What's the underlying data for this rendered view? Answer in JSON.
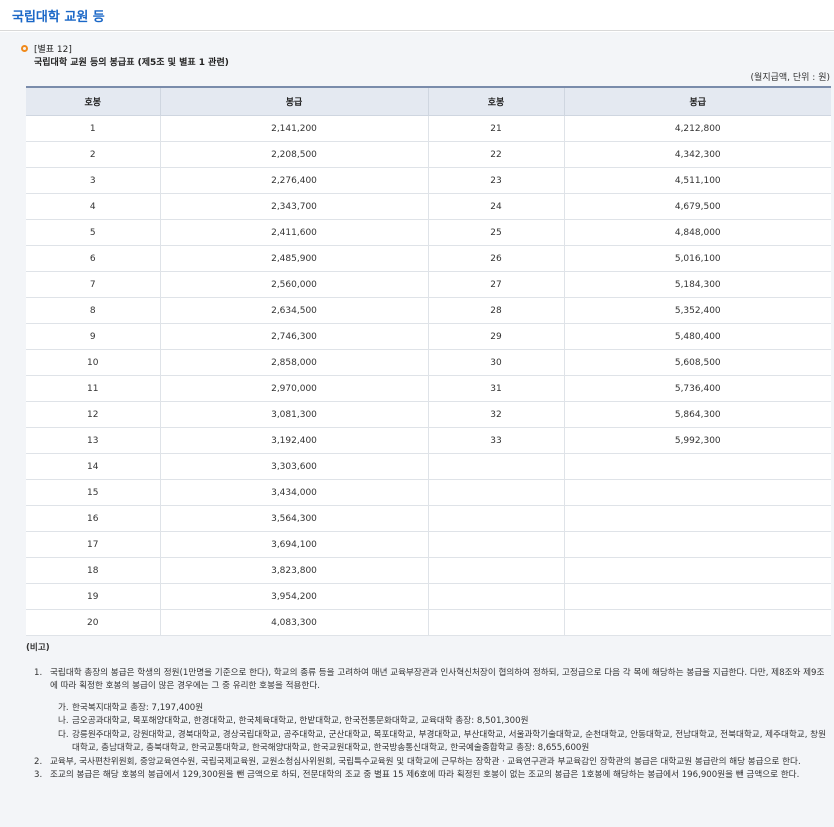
{
  "page_title": "국립대학 교원 등",
  "caption": {
    "label": "[별표 12]",
    "title": "국립대학 교원 등의 봉급표 (제5조 및 별표 1 관련)"
  },
  "unit": "(월지급액, 단위 : 원)",
  "table": {
    "headers": [
      "호봉",
      "봉급",
      "호봉",
      "봉급"
    ],
    "rows": [
      [
        "1",
        "2,141,200",
        "21",
        "4,212,800"
      ],
      [
        "2",
        "2,208,500",
        "22",
        "4,342,300"
      ],
      [
        "3",
        "2,276,400",
        "23",
        "4,511,100"
      ],
      [
        "4",
        "2,343,700",
        "24",
        "4,679,500"
      ],
      [
        "5",
        "2,411,600",
        "25",
        "4,848,000"
      ],
      [
        "6",
        "2,485,900",
        "26",
        "5,016,100"
      ],
      [
        "7",
        "2,560,000",
        "27",
        "5,184,300"
      ],
      [
        "8",
        "2,634,500",
        "28",
        "5,352,400"
      ],
      [
        "9",
        "2,746,300",
        "29",
        "5,480,400"
      ],
      [
        "10",
        "2,858,000",
        "30",
        "5,608,500"
      ],
      [
        "11",
        "2,970,000",
        "31",
        "5,736,400"
      ],
      [
        "12",
        "3,081,300",
        "32",
        "5,864,300"
      ],
      [
        "13",
        "3,192,400",
        "33",
        "5,992,300"
      ],
      [
        "14",
        "3,303,600",
        "",
        ""
      ],
      [
        "15",
        "3,434,000",
        "",
        ""
      ],
      [
        "16",
        "3,564,300",
        "",
        ""
      ],
      [
        "17",
        "3,694,100",
        "",
        ""
      ],
      [
        "18",
        "3,823,800",
        "",
        ""
      ],
      [
        "19",
        "3,954,200",
        "",
        ""
      ],
      [
        "20",
        "4,083,300",
        "",
        ""
      ]
    ]
  },
  "notes": {
    "heading": "(비고)",
    "items": [
      {
        "num": "1.",
        "text": "국립대학 총장의 봉급은 학생의 정원(1만명을 기준으로 한다), 학교의 종류 등을 고려하여 매년 교육부장관과 인사혁신처장이 협의하여 정하되, 고정급으로 다음 각 목에 해당하는 봉급을 지급한다. 다만, 제8조와 제9조에 따라 획정한 호봉의 봉급이 많은 경우에는 그 중 유리한 호봉을 적용한다."
      },
      {
        "num": "2.",
        "text": "교육부, 국사편찬위원회, 중앙교육연수원, 국립국제교육원, 교원소청심사위원회, 국립특수교육원 및 대학교에 근무하는 장학관ㆍ교육연구관과 부교육감인 장학관의 봉급은 대학교원 봉급란의 해당 봉급으로 한다."
      },
      {
        "num": "3.",
        "text": "조교의 봉급은 해당 호봉의 봉급에서 129,300원을 뺀 금액으로 하되, 전문대학의 조교 중 별표 15 제6호에 따라 획정된 호봉이 없는 조교의 봉급은 1호봉에 해당하는 봉급에서 196,900원을 뺀 금액으로 한다."
      }
    ],
    "sub_items": [
      {
        "num": "가.",
        "text": "한국복지대학교 총장: 7,197,400원"
      },
      {
        "num": "나.",
        "text": "금오공과대학교, 목포해양대학교, 한경대학교, 한국체육대학교, 한밭대학교, 한국전통문화대학교, 교육대학 총장: 8,501,300원"
      },
      {
        "num": "다.",
        "text": "강릉원주대학교, 강원대학교, 경북대학교, 경상국립대학교, 공주대학교, 군산대학교, 목포대학교, 부경대학교, 부산대학교, 서울과학기술대학교, 순천대학교, 안동대학교, 전남대학교, 전북대학교, 제주대학교, 창원대학교, 충남대학교, 충북대학교, 한국교통대학교, 한국해양대학교, 한국교원대학교, 한국방송통신대학교, 한국예술종합학교 총장: 8,655,600원"
      }
    ]
  }
}
